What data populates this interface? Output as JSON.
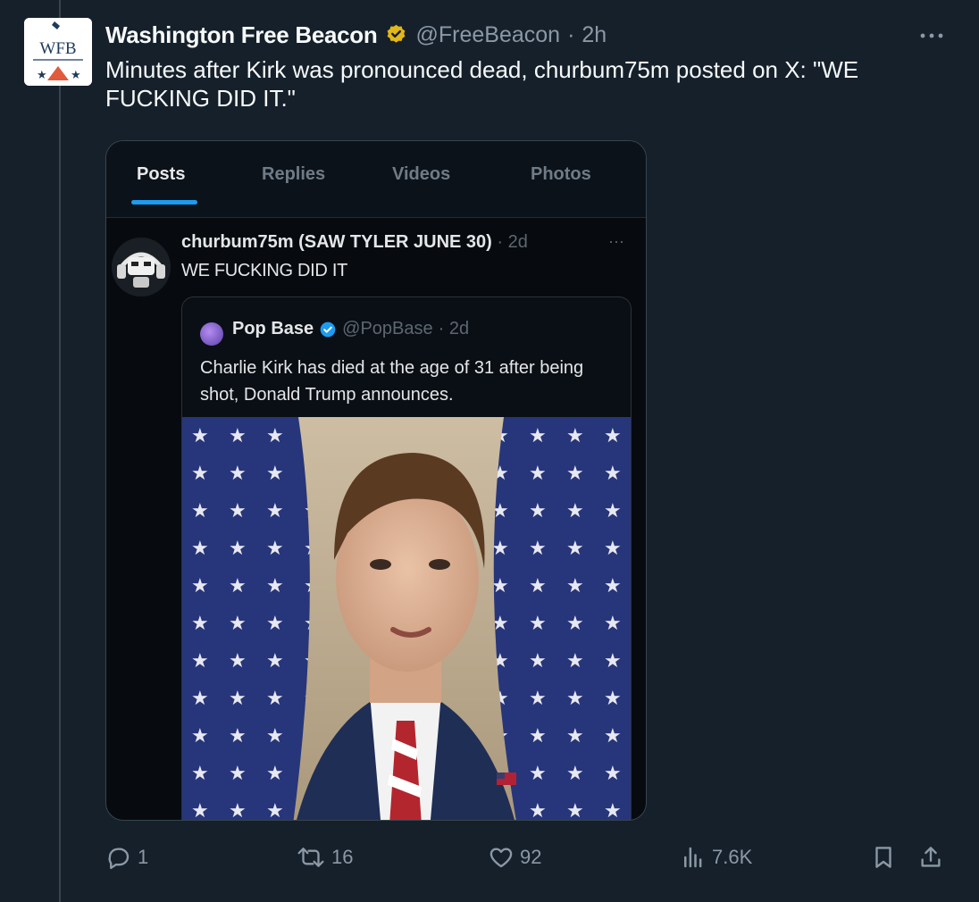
{
  "tweet": {
    "avatar_text": "WFB",
    "display_name": "Washington Free Beacon",
    "handle": "@FreeBeacon",
    "separator": "·",
    "time": "2h",
    "text": "Minutes after Kirk was pronounced dead, churbum75m posted on X: \"WE FUCKING DID IT.\"",
    "verified_badge_color": "#e2b719"
  },
  "media": {
    "tabs": [
      {
        "label": "Posts",
        "active": true
      },
      {
        "label": "Replies",
        "active": false
      },
      {
        "label": "Videos",
        "active": false
      },
      {
        "label": "Photos",
        "active": false
      }
    ],
    "inner_post": {
      "name": "churbum75m (SAW TYLER JUNE 30)",
      "time": "· 2d",
      "more": "···",
      "text": "WE FUCKING DID IT"
    },
    "quote": {
      "name": "Pop Base",
      "handle": "@PopBase",
      "time": "· 2d",
      "text": "Charlie Kirk has died at the age of 31 after being shot, Donald Trump announces."
    }
  },
  "actions": {
    "replies": "1",
    "reposts": "16",
    "likes": "92",
    "views": "7.6K"
  },
  "colors": {
    "background": "#15202b",
    "accent": "#1d9bf0",
    "muted": "#8b98a5"
  }
}
